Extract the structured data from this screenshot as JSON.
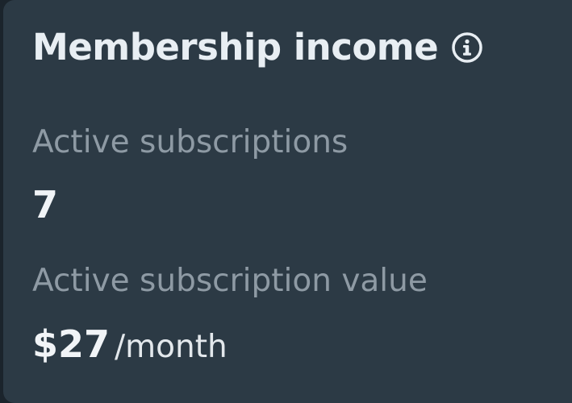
{
  "card": {
    "title": "Membership income",
    "info_icon": "info-icon",
    "metrics": [
      {
        "label": "Active subscriptions",
        "value": "7"
      },
      {
        "label": "Active subscription value",
        "value": "$27",
        "unit": "/month"
      }
    ]
  },
  "colors": {
    "card_background": "#2c3a45",
    "page_background": "#1b242c",
    "title": "#e8eef3",
    "label": "#8e9aa4",
    "value": "#f1f4f7"
  }
}
